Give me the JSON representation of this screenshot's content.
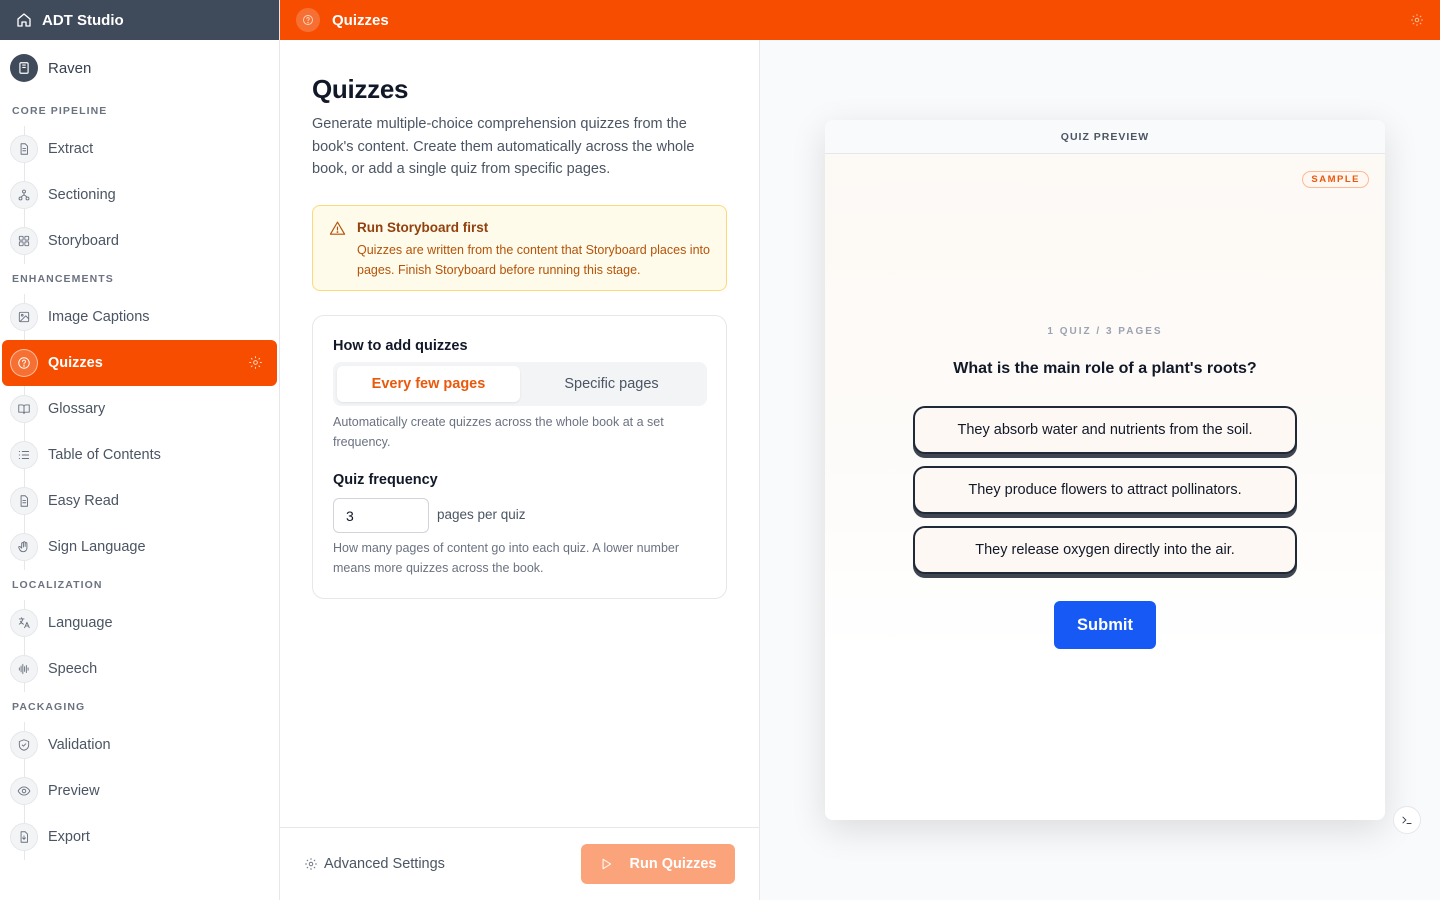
{
  "app": {
    "title": "ADT Studio"
  },
  "book": {
    "name": "Raven"
  },
  "sidebar": {
    "sections": [
      {
        "label": "CORE PIPELINE",
        "items": [
          {
            "label": "Extract",
            "icon": "document-icon"
          },
          {
            "label": "Sectioning",
            "icon": "hierarchy-icon"
          },
          {
            "label": "Storyboard",
            "icon": "grid-icon"
          }
        ]
      },
      {
        "label": "ENHANCEMENTS",
        "items": [
          {
            "label": "Image Captions",
            "icon": "image-icon"
          },
          {
            "label": "Quizzes",
            "icon": "question-circle-icon",
            "active": true
          },
          {
            "label": "Glossary",
            "icon": "book-open-icon"
          },
          {
            "label": "Table of Contents",
            "icon": "list-icon"
          },
          {
            "label": "Easy Read",
            "icon": "document-icon"
          },
          {
            "label": "Sign Language",
            "icon": "hand-icon"
          }
        ]
      },
      {
        "label": "LOCALIZATION",
        "items": [
          {
            "label": "Language",
            "icon": "translate-icon"
          },
          {
            "label": "Speech",
            "icon": "audio-wave-icon"
          }
        ]
      },
      {
        "label": "PACKAGING",
        "items": [
          {
            "label": "Validation",
            "icon": "shield-check-icon"
          },
          {
            "label": "Preview",
            "icon": "eye-icon"
          },
          {
            "label": "Export",
            "icon": "file-export-icon"
          }
        ]
      }
    ]
  },
  "topbar": {
    "title": "Quizzes"
  },
  "main": {
    "title": "Quizzes",
    "description": "Generate multiple-choice comprehension quizzes from the book's content. Create them automatically across the whole book, or add a single quiz from specific pages.",
    "warning": {
      "title": "Run Storyboard first",
      "text": "Quizzes are written from the content that Storyboard places into pages. Finish Storyboard before running this stage."
    },
    "card": {
      "title": "How to add quizzes",
      "options": [
        "Every few pages",
        "Specific pages"
      ],
      "selected_option": "Every few pages",
      "help": "Automatically create quizzes across the whole book at a set frequency.",
      "frequency_label": "Quiz frequency",
      "frequency_value": "3",
      "frequency_unit": "pages per quiz",
      "frequency_help": "How many pages of content go into each quiz. A lower number means more quizzes across the book."
    },
    "footer": {
      "advanced_label": "Advanced Settings",
      "run_label": "Run Quizzes"
    }
  },
  "preview": {
    "header": "QUIZ PREVIEW",
    "badge": "SAMPLE",
    "meta": "1 QUIZ / 3 PAGES",
    "question": "What is the main role of a plant's roots?",
    "answers": [
      "They absorb water and nutrients from the soil.",
      "They produce flowers to attract pollinators.",
      "They release oxygen directly into the air."
    ],
    "submit_label": "Submit"
  },
  "colors": {
    "accent": "#f64d00",
    "sidebar_brand": "#3f4a5a",
    "submit": "#1659f5",
    "warning_bg": "#fffbeb"
  }
}
